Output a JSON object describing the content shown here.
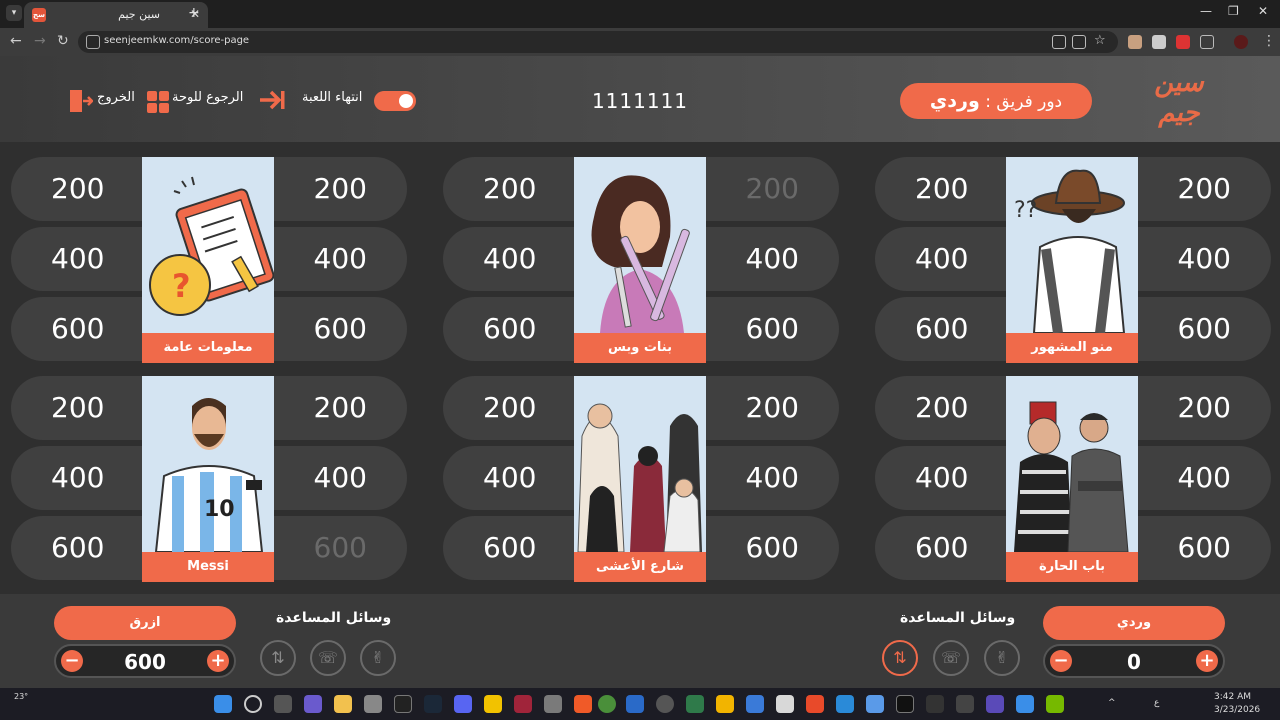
{
  "browser": {
    "tab_title": "سين جيم",
    "url": "seenjeemkw.com/score-page",
    "new_tab": "+",
    "close": "✕"
  },
  "header": {
    "logo_line1": "سين",
    "logo_line2": "جيم",
    "turn_label": "دور فريق :",
    "turn_team": "وردي",
    "score_title": "1111111",
    "end_game": "انتهاء اللعبة",
    "back_board": "الرجوع للوحة",
    "exit": "الخروج"
  },
  "categories": [
    {
      "name": "معلومات عامة",
      "left": [
        "200",
        "400",
        "600"
      ],
      "right": [
        "200",
        "400",
        "600"
      ],
      "used_left": [],
      "used_right": []
    },
    {
      "name": "بنات وبس",
      "left": [
        "200",
        "400",
        "600"
      ],
      "right": [
        "200",
        "400",
        "600"
      ],
      "used_left": [],
      "used_right": [
        0
      ]
    },
    {
      "name": "منو المشهور",
      "left": [
        "200",
        "400",
        "600"
      ],
      "right": [
        "200",
        "400",
        "600"
      ],
      "used_left": [],
      "used_right": []
    },
    {
      "name": "Messi",
      "left": [
        "200",
        "400",
        "600"
      ],
      "right": [
        "200",
        "400",
        "600"
      ],
      "used_left": [],
      "used_right": [
        2
      ]
    },
    {
      "name": "شارع الأعشى",
      "left": [
        "200",
        "400",
        "600"
      ],
      "right": [
        "200",
        "400",
        "600"
      ],
      "used_left": [],
      "used_right": []
    },
    {
      "name": "باب الحارة",
      "left": [
        "200",
        "400",
        "600"
      ],
      "right": [
        "200",
        "400",
        "600"
      ],
      "used_left": [],
      "used_right": []
    }
  ],
  "footer": {
    "team_left": {
      "name": "ازرق",
      "score": "600"
    },
    "team_right": {
      "name": "وردي",
      "score": "0"
    },
    "aids_label": "وسائل المساعدة",
    "minus": "−",
    "plus": "+"
  },
  "taskbar": {
    "weather": "23°",
    "time": "3:42 AM",
    "date": "3/23/2026",
    "lang": "ع"
  },
  "colors": {
    "accent": "#f06a4a",
    "pill": "#404040",
    "board": "#2f2f2f"
  }
}
